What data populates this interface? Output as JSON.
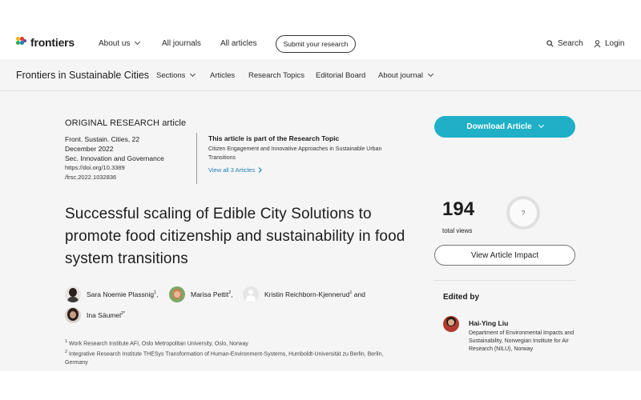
{
  "header": {
    "logo_text": "frontiers",
    "nav": [
      {
        "label": "About us",
        "has_dropdown": true
      },
      {
        "label": "All journals",
        "has_dropdown": false
      },
      {
        "label": "All articles",
        "has_dropdown": false
      }
    ],
    "submit_label": "Submit your research",
    "search_label": "Search",
    "login_label": "Login",
    "icons": [
      "search-icon",
      "user-icon",
      "chevron-down-icon"
    ]
  },
  "journal_bar": {
    "title": "Frontiers in Sustainable Cities",
    "nav": [
      {
        "label": "Sections",
        "has_dropdown": true
      },
      {
        "label": "Articles",
        "has_dropdown": false
      },
      {
        "label": "Research Topics",
        "has_dropdown": false
      },
      {
        "label": "Editorial Board",
        "has_dropdown": false
      },
      {
        "label": "About journal",
        "has_dropdown": true
      }
    ]
  },
  "article": {
    "type": "ORIGINAL RESEARCH article",
    "citation_line1": "Front. Sustain. Cities, 22",
    "citation_line2": "December 2022",
    "section": "Sec. Innovation and Governance",
    "doi_line1": "https://doi.org/10.3389",
    "doi_line2": "/frsc.2022.1032836",
    "topic_header": "This article is part of the Research Topic",
    "topic_name": "Citizen Engagement and Innovative Approaches in Sustainable Urban Transitions",
    "topic_link": "View all 3 Articles",
    "title": "Successful scaling of Edible City Solutions to promote food citizenship and sustainability in food system transitions",
    "authors": [
      {
        "name": "Sara Noemie Plassnig",
        "sup": "1",
        "sep": ","
      },
      {
        "name": "Marisa Pettit",
        "sup": "2",
        "sep": ","
      },
      {
        "name": "Kristin Reichborn-Kjennerud",
        "sup": "1",
        "sep": " and"
      },
      {
        "name": "Ina Säumel",
        "sup": "2*",
        "sep": ""
      }
    ],
    "affiliations": [
      {
        "sup": "1",
        "text": "Work Research Institute AFI, Oslo Metropolitan University, Oslo, Norway"
      },
      {
        "sup": "2",
        "text": "Integrative Research Institute THESys Transformation of Human-Environment-Systems, Humboldt-Universität zu Berlin, Berlin, Germany"
      }
    ]
  },
  "sidebar": {
    "download_label": "Download Article",
    "views_count": "194",
    "views_label": "total views",
    "altmetric_placeholder": "?",
    "impact_label": "View Article Impact",
    "edited_by_label": "Edited by",
    "editor_name": "Hai-Ying Liu",
    "editor_affiliation": "Department of Environmental Impacts and Sustainability, Norwegian Institute for Air Research (NILU), Norway"
  },
  "colors": {
    "accent": "#1fb0c8",
    "link": "#1b7fb7",
    "page_bg": "#f5f5f5"
  }
}
